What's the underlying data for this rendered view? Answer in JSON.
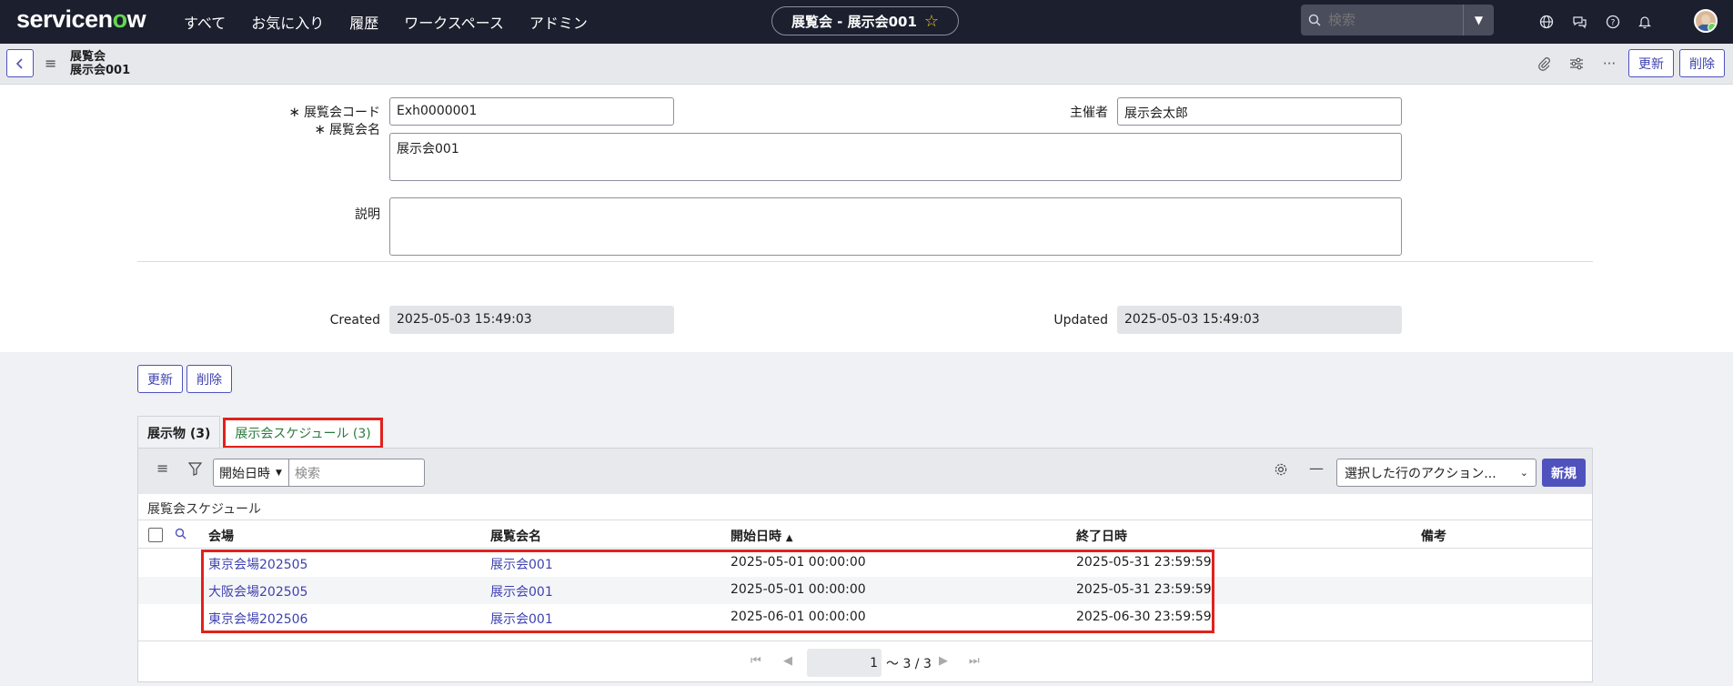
{
  "nav": {
    "logo_a": "servicen",
    "logo_o": "o",
    "logo_b": "w",
    "items": [
      "すべて",
      "お気に入り",
      "履歴",
      "ワークスペース",
      "アドミン"
    ],
    "context_title": "展覧会 - 展示会001",
    "search_placeholder": "検索"
  },
  "record": {
    "title_line1": "展覧会",
    "title_line2": "展示会001",
    "update_label": "更新",
    "delete_label": "削除"
  },
  "form": {
    "code_label": "展覧会コード",
    "code_value": "Exh0000001",
    "organizer_label": "主催者",
    "organizer_value": "展示会太郎",
    "name_label": "展覧会名",
    "name_value": "展示会001",
    "desc_label": "説明",
    "desc_value": "",
    "created_label": "Created",
    "created_value": "2025-05-03 15:49:03",
    "updated_label": "Updated",
    "updated_value": "2025-05-03 15:49:03",
    "required_mark": "∗"
  },
  "bottom_buttons": {
    "update": "更新",
    "delete": "削除"
  },
  "tabs": [
    {
      "label": "展示物 (3)"
    },
    {
      "label": "展示会スケジュール (3)"
    }
  ],
  "list": {
    "sort_field": "開始日時",
    "search_placeholder": "検索",
    "actions_label": "選択した行のアクション...",
    "new_label": "新規",
    "title": "展覧会スケジュール",
    "columns": [
      "会場",
      "展覧会名",
      "開始日時",
      "終了日時",
      "備考"
    ],
    "sort_indicator": "▲",
    "rows": [
      {
        "venue": "東京会場202505",
        "name": "展示会001",
        "start": "2025-05-01 00:00:00",
        "end": "2025-05-31 23:59:59",
        "note": ""
      },
      {
        "venue": "大阪会場202505",
        "name": "展示会001",
        "start": "2025-05-01 00:00:00",
        "end": "2025-05-31 23:59:59",
        "note": ""
      },
      {
        "venue": "東京会場202506",
        "name": "展示会001",
        "start": "2025-06-01 00:00:00",
        "end": "2025-06-30 23:59:59",
        "note": ""
      }
    ],
    "pager": {
      "page": "1",
      "range": "〜 3 / 3"
    }
  },
  "colors": {
    "nav_bg": "#1b1f2e",
    "accent": "#4f52bd",
    "highlight": "#e2211c",
    "logo_green": "#62d84e"
  }
}
